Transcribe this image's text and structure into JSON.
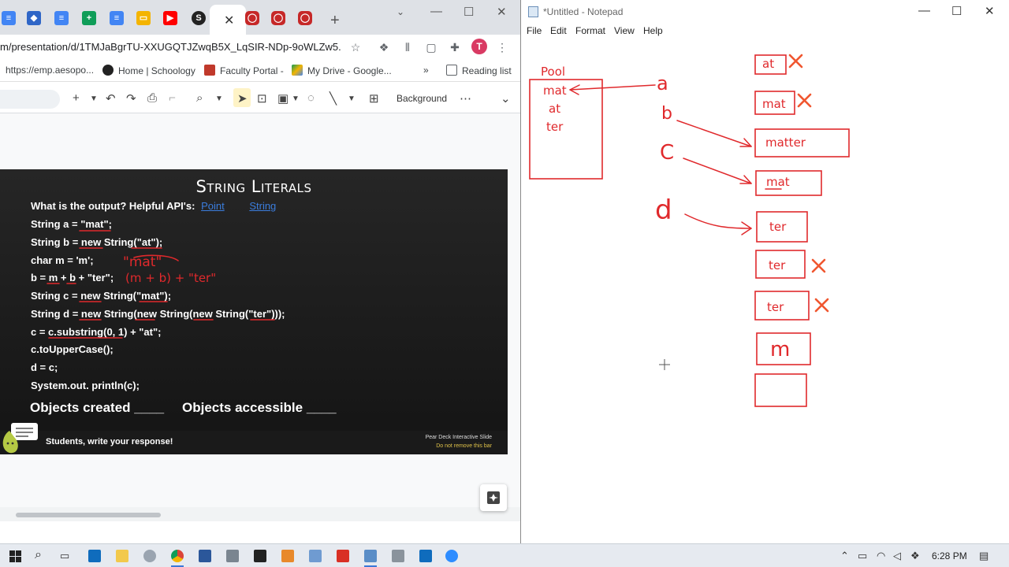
{
  "browser": {
    "url": "m/presentation/d/1TMJaBgrTU-XXUGQTJZwqB5X_LqSIR-NDp-9oWLZw5...",
    "avatar_letter": "T",
    "tab_icons": [
      "docs-icon",
      "stack-icon",
      "docs-icon",
      "sheets-icon",
      "docs-icon",
      "slides-icon",
      "youtube-icon",
      "schoology-icon",
      "oracle-icon",
      "oracle-icon",
      "oracle-icon"
    ],
    "bookmarks": [
      {
        "label": "https://emp.aesopo...",
        "icon": "globe-icon"
      },
      {
        "label": "Home | Schoology",
        "icon": "schoology-icon"
      },
      {
        "label": "Faculty Portal -",
        "icon": "portal-icon"
      },
      {
        "label": "My Drive - Google...",
        "icon": "drive-icon"
      }
    ],
    "bookmarks_more": "»",
    "reading_list": "Reading list",
    "toolbar": {
      "background_label": "Background"
    }
  },
  "slide": {
    "title": "String Literals",
    "prompt": "What is the output? Helpful API's:",
    "api_links": [
      "Point",
      "String"
    ],
    "code_lines": [
      "String a = \"mat\";",
      "String b = new String(\"at\");",
      "char m = 'm';",
      "b = m + b + \"ter\";",
      "String c = new String(\"mat\");",
      "String d = new String(new String(new String(\"ter\")));",
      "c = c.substring(0, 1) + \"at\";",
      "c.toUpperCase();",
      "d = c;",
      "System.out. println(c);"
    ],
    "objects_created": "Objects created ____",
    "objects_accessible": "Objects accessible ____",
    "annotations": {
      "mat_note": "\"mat\"",
      "expr_note": "(m + b) + \"ter\""
    },
    "peardeck": {
      "cta": "Students, write your response!",
      "line1": "Pear Deck Interactive Slide",
      "line2": "Do not remove this bar"
    }
  },
  "notepad": {
    "title": "*Untitled - Notepad",
    "menu": [
      "File",
      "Edit",
      "Format",
      "View",
      "Help"
    ],
    "pool_label": "Pool",
    "pool_items": [
      "mat",
      "at",
      "ter"
    ],
    "var_labels": [
      "a",
      "b",
      "C",
      "d"
    ],
    "boxes": [
      {
        "text": "at",
        "crossed": true
      },
      {
        "text": "mat",
        "crossed": true
      },
      {
        "text": "matter",
        "crossed": false
      },
      {
        "text": "mat",
        "crossed": false
      },
      {
        "text": "ter",
        "crossed": false
      },
      {
        "text": "ter",
        "crossed": true
      },
      {
        "text": "ter",
        "crossed": true
      },
      {
        "text": "m",
        "crossed": false
      },
      {
        "text": "",
        "crossed": false
      }
    ]
  },
  "taskbar": {
    "time": "6:28 PM"
  },
  "colors": {
    "ink": "#e0292c",
    "cross": "#f0562f",
    "slide_bg": "#1c1c1c",
    "link": "#3b7ddd"
  }
}
